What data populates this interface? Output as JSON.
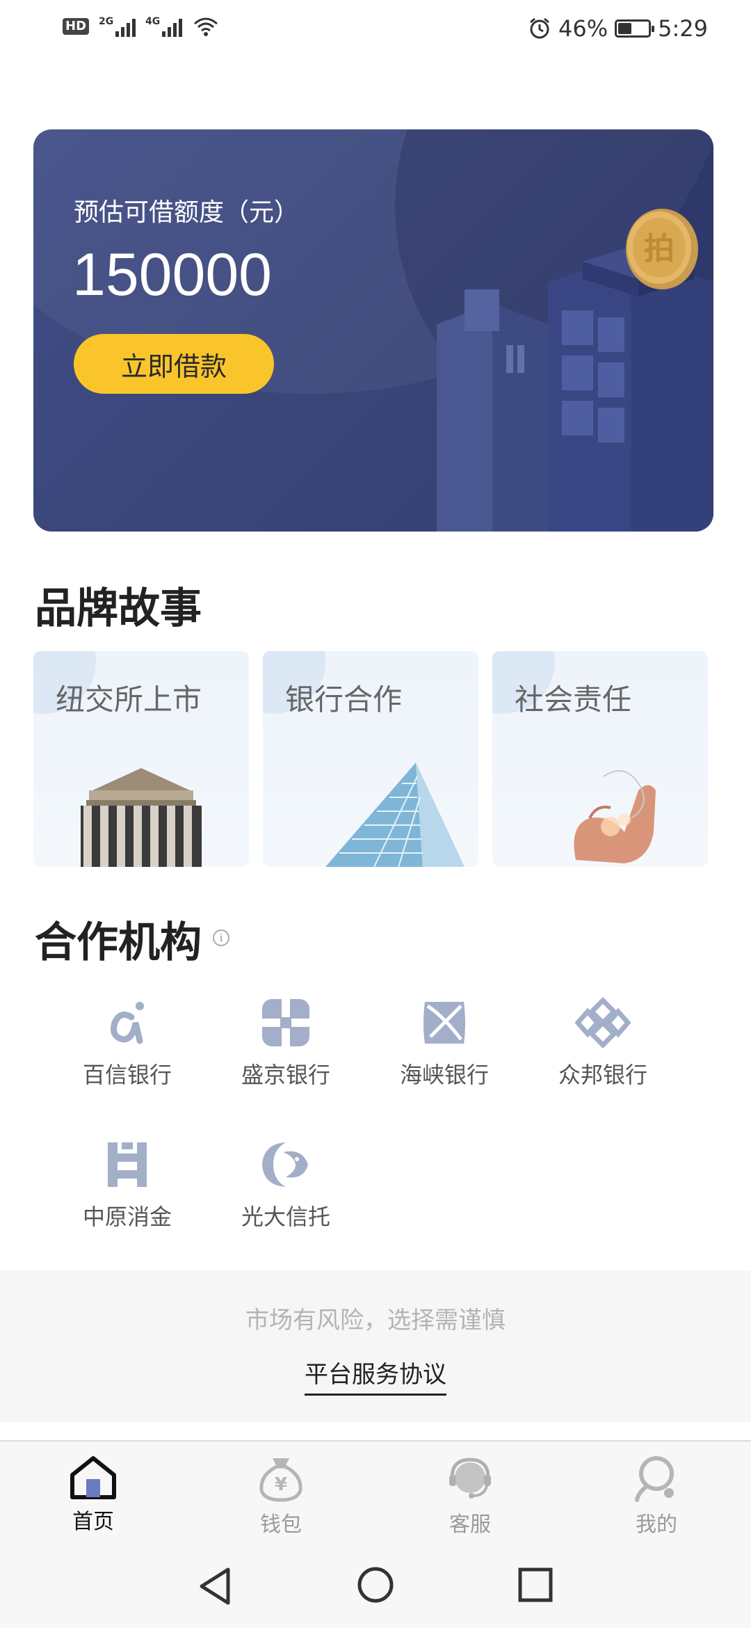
{
  "status_bar": {
    "network_left": "2G",
    "network_right": "4G",
    "battery_percent": "46%",
    "battery_level": 0.46,
    "time": "5:29"
  },
  "hero": {
    "label": "预估可借额度（元）",
    "amount": "150000",
    "button": "立即借款",
    "coin_glyph": "拍"
  },
  "brand_story": {
    "title": "品牌故事",
    "cards": [
      {
        "label": "纽交所上市",
        "icon": "stock-exchange-building"
      },
      {
        "label": "银行合作",
        "icon": "glass-skyscraper"
      },
      {
        "label": "社会责任",
        "icon": "hands-with-lights"
      }
    ]
  },
  "partners": {
    "title": "合作机构",
    "info_icon": "info-icon",
    "items": [
      {
        "name": "百信银行",
        "icon": "aibank-logo"
      },
      {
        "name": "盛京银行",
        "icon": "shengjing-bank-logo"
      },
      {
        "name": "海峡银行",
        "icon": "haixia-bank-logo"
      },
      {
        "name": "众邦银行",
        "icon": "zhongbang-bank-logo"
      },
      {
        "name": "中原消金",
        "icon": "zhongyuan-logo"
      },
      {
        "name": "光大信托",
        "icon": "everbright-trust-logo"
      }
    ]
  },
  "footer": {
    "risk_notice": "市场有风险，选择需谨慎",
    "agreement_link": "平台服务协议"
  },
  "tabs": [
    {
      "label": "首页",
      "icon": "home-icon",
      "active": true
    },
    {
      "label": "钱包",
      "icon": "wallet-icon",
      "active": false
    },
    {
      "label": "客服",
      "icon": "customer-service-icon",
      "active": false
    },
    {
      "label": "我的",
      "icon": "profile-icon",
      "active": false
    }
  ],
  "colors": {
    "hero_bg": "#394478",
    "accent_button": "#f9c52b",
    "partner_logo": "#a3aec8",
    "tab_active": "#111111",
    "tab_inactive": "#9a9a9a"
  }
}
